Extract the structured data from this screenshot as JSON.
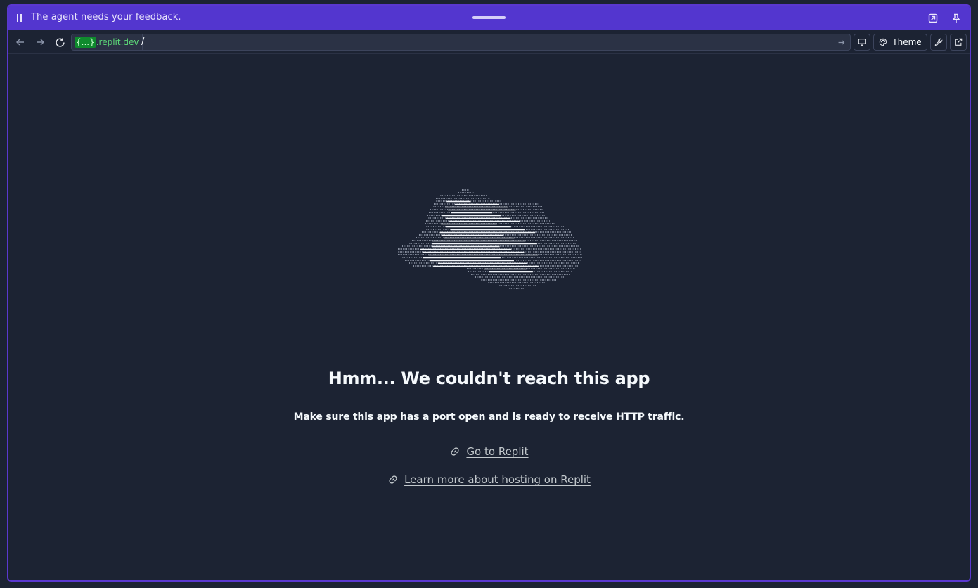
{
  "banner": {
    "message": "The agent needs your feedback.",
    "pause_icon": "pause-icon",
    "expand_icon": "expand-icon",
    "pin_icon": "pin-icon"
  },
  "toolbar": {
    "back_icon": "arrow-left-icon",
    "forward_icon": "arrow-right-icon",
    "reload_icon": "reload-icon",
    "domain_highlight": "{...}",
    "domain_suffix": ".replit.dev",
    "path": "/",
    "go_icon": "arrow-right-icon",
    "device_icon": "monitor-icon",
    "theme_label": "Theme",
    "theme_icon": "palette-icon",
    "devtools_icon": "wrench-icon",
    "open_external_icon": "external-link-icon"
  },
  "content": {
    "illustration": "ascii-cloud",
    "title": "Hmm... We couldn't reach this app",
    "subtitle": "Make sure this app has a port open and is ready to receive HTTP traffic.",
    "links": [
      {
        "label": "Go to Replit",
        "icon": "link-icon"
      },
      {
        "label": "Learn more about hosting on Replit",
        "icon": "link-icon"
      }
    ]
  },
  "colors": {
    "background": "#1c2333",
    "banner": "#5336cf",
    "frame_border": "#5a38d0",
    "domain_green": "#5cd878",
    "text": "#f5f9fc",
    "link": "#c2c8cc"
  }
}
